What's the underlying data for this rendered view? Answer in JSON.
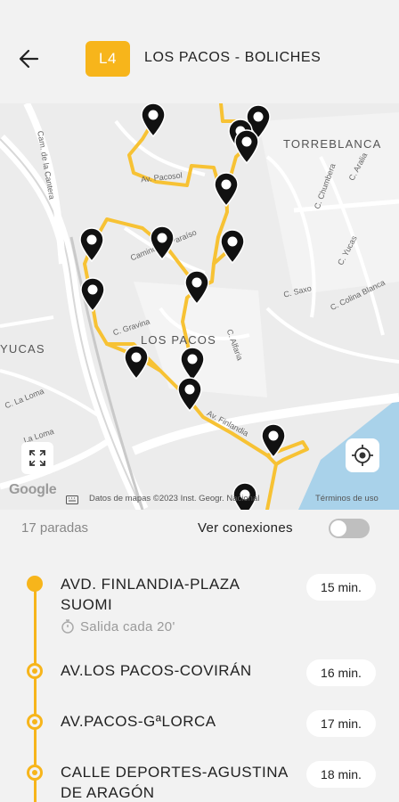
{
  "header": {
    "line_badge": "L4",
    "title": "LOS PACOS - BOLICHES",
    "back_icon": "arrow-left-icon"
  },
  "map": {
    "labels": {
      "torreblanca": "TORREBLANCA",
      "los_pacos": "LOS PACOS",
      "yucas": "YUCAS"
    },
    "streets": {
      "carretera": "Cam. de la Cantera",
      "pacosol": "Av. Pacosol",
      "paraiso": "Camino del Paraíso",
      "gravina": "C. Gravina",
      "alfaria": "C. Alfaria",
      "saxo": "C. Saxo",
      "colina": "C. Colina Blanca",
      "yucas_st": "C. Yucas",
      "chumbera": "C. Chumbera",
      "aralia": "C. Aralia",
      "la_loma": "C. La Loma",
      "finlandia": "Av. Finlandia",
      "loma2": "La Loma"
    },
    "google": "Google",
    "attribution": "Datos de mapas ©2023 Inst. Geogr. Nacional",
    "terms": "Términos de uso",
    "route_color": "#f7c234",
    "marker_color": "#111111"
  },
  "controls": {
    "stops_count": "17 paradas",
    "connections_label": "Ver conexiones",
    "connections_on": false
  },
  "stops": [
    {
      "name": "AVD. FINLANDIA-PLAZA SUOMI",
      "sub": "Salida cada 20'",
      "time": "15 min."
    },
    {
      "name": "AV.LOS PACOS-COVIRÁN",
      "time": "16 min."
    },
    {
      "name": "AV.PACOS-GªLORCA",
      "time": "17 min."
    },
    {
      "name": "CALLE DEPORTES-AGUSTINA DE ARAGÓN",
      "time": "18 min."
    }
  ],
  "accent": "#f7b51b"
}
